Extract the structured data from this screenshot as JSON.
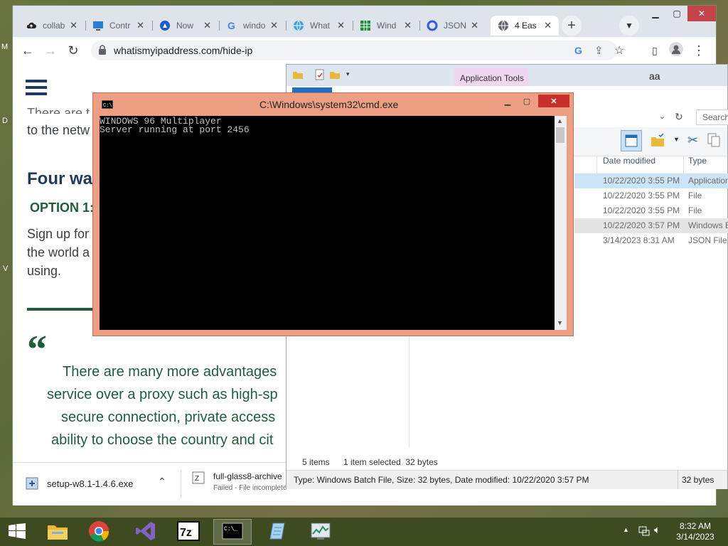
{
  "desktop": {
    "edge_letters": [
      "M",
      "D",
      "V"
    ]
  },
  "chrome": {
    "tabs": [
      {
        "title": "collab",
        "icon": "cloud-icon"
      },
      {
        "title": "Contr",
        "icon": "monitor-icon"
      },
      {
        "title": "Now",
        "icon": "atlas-icon"
      },
      {
        "title": "windo",
        "icon": "google-icon"
      },
      {
        "title": "What",
        "icon": "globe-icon"
      },
      {
        "title": "Wind",
        "icon": "spreadsheet-icon"
      },
      {
        "title": "JSON",
        "icon": "json-icon"
      },
      {
        "title": "4 Eas",
        "icon": "globe-icon",
        "active": true
      }
    ],
    "new_tab": "+",
    "url": "whatismyipaddress.com/hide-ip"
  },
  "page": {
    "partial_text_1": "There are t",
    "partial_text_2": "to the netw",
    "heading": "Four wa",
    "option": "OPTION 1:",
    "para_lines": [
      "Sign up for",
      "the world a",
      "using."
    ],
    "quote_mark": "“",
    "quote_lines": [
      "There are many more advantages",
      "service over a proxy such as high-sp",
      "secure connection, private access",
      "ability to choose the country and cit"
    ]
  },
  "downloads": [
    {
      "name": "setup-w8.1-1.4.6.exe",
      "status": ""
    },
    {
      "name": "full-glass8-archive",
      "status": "Failed - File incomplete"
    }
  ],
  "explorer": {
    "ribbon_tab": "Application Tools",
    "title_text": "aa",
    "search_placeholder": "Search",
    "columns": {
      "date": "Date modified",
      "type": "Type"
    },
    "files": [
      {
        "date": "10/22/2020 3:55 PM",
        "type": "Application",
        "selected": true
      },
      {
        "date": "10/22/2020 3:55 PM",
        "type": "File"
      },
      {
        "date": "10/22/2020 3:55 PM",
        "type": "File"
      },
      {
        "date": "10/22/2020 3:57 PM",
        "type": "Windows B",
        "highlight": true
      },
      {
        "date": "3/14/2023 8:31 AM",
        "type": "JSON File"
      }
    ],
    "status_items": "5 items",
    "status_selected": "1 item selected  32 bytes",
    "details": "Type: Windows Batch File, Size: 32 bytes, Date modified: 10/22/2020 3:57 PM",
    "details_size": "32 bytes"
  },
  "cmd": {
    "title": "C:\\Windows\\system32\\cmd.exe",
    "lines": [
      "WINDOWS 96 Multiplayer",
      "Server running at port 2456"
    ]
  },
  "taskbar": {
    "time": "8:32 AM",
    "date": "3/14/2023"
  }
}
